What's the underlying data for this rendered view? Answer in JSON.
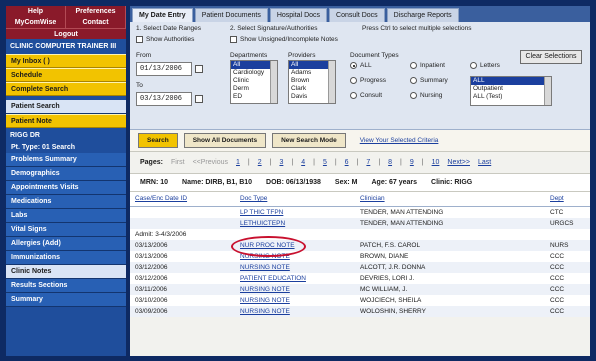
{
  "sidebar": {
    "top_buttons": [
      "Help",
      "Preferences"
    ],
    "second_row": [
      "MyComWise",
      "Contact"
    ],
    "logout": "Logout",
    "header": "CLINIC COMPUTER TRAINER III",
    "yellow_items": [
      "My Inbox ( ) ",
      "Schedule",
      "Complete Search"
    ],
    "blue_items_a": [
      "Patient Search",
      "Patient Note"
    ],
    "patient_header": "RIGG DR",
    "patient_sub": "Pt. Type: 01 Search",
    "blue_items_b": [
      "Problems Summary",
      "Demographics",
      "Appointments Visits",
      "Medications",
      "Labs",
      "Vital Signs",
      "Allergies (Add)",
      "Immunizations"
    ],
    "selected_item": "Clinic Notes",
    "blue_items_c": [
      "Results Sections",
      "Summary"
    ]
  },
  "tabs": [
    "My Date Entry",
    "Patient Documents",
    "Hospital Docs",
    "Consult Docs",
    "Discharge Reports"
  ],
  "filters": {
    "col1_header": "1. Select Date Ranges",
    "col2_header": "2. Select Signature/Authorities",
    "col3_header": "Press Ctrl to select multiple selections",
    "chk1": "Show Authorities",
    "chk2": "Show Unsigned/Incomplete Notes",
    "from_label": "From",
    "from_value": "01/13/2006",
    "to_label": "To",
    "to_value": "03/13/2006",
    "list1_label": "Departments",
    "list1_items": [
      "All",
      "Cardiology",
      "Clinic",
      "Derm",
      "ED"
    ],
    "list2_label": "Providers",
    "list2_items": [
      "All",
      "Adams",
      "Brown",
      "Clark",
      "Davis"
    ],
    "doc_types_label": "Document Types",
    "radios": [
      "ALL",
      "Progress",
      "Consult",
      "Inpatient",
      "Summary",
      "Nursing",
      "Letters"
    ],
    "list3_items": [
      "ALL",
      "Outpatient",
      "ALL (Test)"
    ],
    "clear_button": "Clear Selections"
  },
  "actions": {
    "search": "Search",
    "show_all": "Show All Documents",
    "new_search": "New Search Mode",
    "view_link": "View Your Selected Criteria"
  },
  "pager": {
    "label": "Pages:",
    "first": "First",
    "previous": "<<Previous",
    "pages": [
      "1",
      "2",
      "3",
      "4",
      "5",
      "6",
      "7",
      "8",
      "9",
      "10"
    ],
    "next": "Next>>",
    "last": "Last"
  },
  "patient": {
    "mrn": "MRN: 10",
    "name": "Name: DIRB, B1, B10",
    "dob": "DOB: 06/13/1938",
    "sex": "Sex: M",
    "age": "Age: 67 years",
    "clinic": "Clinic: RIGG"
  },
  "table": {
    "headers": [
      "Case/Enc Date ID",
      "Doc Type",
      "Clinician",
      "Dept"
    ],
    "rows": [
      {
        "date": "",
        "type": "LP THIC TFPN",
        "clin": "TENDER, MAN ATTENDING",
        "dept": "CTC"
      },
      {
        "date": "",
        "type": "LETHUICTEPN",
        "clin": "TENDER, MAN ATTENDING",
        "dept": "URGCS"
      },
      {
        "date": "Admit: 3-4/3/2006",
        "type": "",
        "clin": "",
        "dept": ""
      },
      {
        "date": "03/13/2006",
        "type": "NUR PROC NOTE",
        "clin": "PATCH, F.S. CAROL",
        "dept": "NURS"
      },
      {
        "date": "03/13/2006",
        "type": "NURSING NOTE",
        "clin": "BROWN, DIANE",
        "dept": "CCC"
      },
      {
        "date": "03/12/2006",
        "type": "NURSING NOTE",
        "clin": "ALCOTT, J.R. DONNA",
        "dept": "CCC"
      },
      {
        "date": "03/12/2006",
        "type": "PATIENT EDUCATION",
        "clin": "DEVRIES, LORI J.",
        "dept": "CCC"
      },
      {
        "date": "03/11/2006",
        "type": "NURSING NOTE",
        "clin": "MC WILLIAM, J.",
        "dept": "CCC"
      },
      {
        "date": "03/10/2006",
        "type": "NURSING NOTE",
        "clin": "WOJCIECH, SHEILA",
        "dept": "CCC"
      },
      {
        "date": "03/09/2006",
        "type": "NURSING NOTE",
        "clin": "WOLOSHIN, SHERRY",
        "dept": "CCC"
      }
    ]
  }
}
